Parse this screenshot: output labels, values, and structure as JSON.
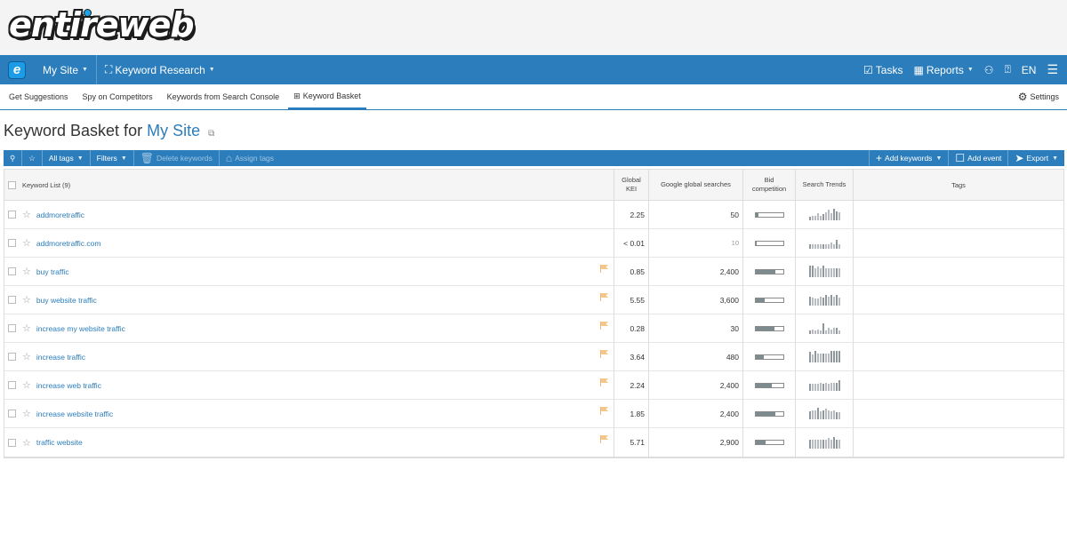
{
  "logo": {
    "text": "entireweb"
  },
  "topnav": {
    "app_icon": "e",
    "site": "My Site",
    "module": "Keyword Research",
    "tasks": "Tasks",
    "reports": "Reports",
    "lang": "EN"
  },
  "subnav": {
    "tabs": [
      "Get Suggestions",
      "Spy on Competitors",
      "Keywords from Search Console",
      "Keyword Basket"
    ],
    "settings": "Settings"
  },
  "page": {
    "title_prefix": "Keyword Basket for",
    "site": "My Site"
  },
  "toolbar": {
    "all_tags": "All tags",
    "filters": "Filters",
    "delete": "Delete keywords",
    "assign": "Assign tags",
    "add_keywords": "Add keywords",
    "add_event": "Add event",
    "export": "Export"
  },
  "table": {
    "headers": {
      "keyword": "Keyword List (9)",
      "kei_1": "Global",
      "kei_2": "KEI",
      "searches": "Google global searches",
      "bid_1": "Bid",
      "bid_2": "competition",
      "trends": "Search Trends",
      "tags": "Tags"
    },
    "rows": [
      {
        "keyword": "addmoretraffic",
        "kei": "2.25",
        "searches": "50",
        "flag": false,
        "bid": 0.12,
        "trend": [
          3,
          4,
          4,
          6,
          4,
          5,
          7,
          9,
          6,
          10,
          8,
          7
        ]
      },
      {
        "keyword": "addmoretraffic.com",
        "kei": "< 0.01",
        "searches": "10",
        "muted": true,
        "flag": false,
        "bid": 0.02,
        "trend": [
          4,
          4,
          4,
          4,
          4,
          4,
          4,
          4,
          5,
          4,
          8,
          4
        ]
      },
      {
        "keyword": "buy traffic",
        "kei": "0.85",
        "searches": "2,400",
        "flag": true,
        "bid": 0.72,
        "trend": [
          10,
          10,
          8,
          9,
          8,
          10,
          8,
          8,
          8,
          8,
          8,
          8
        ]
      },
      {
        "keyword": "buy website traffic",
        "kei": "5.55",
        "searches": "3,600",
        "flag": true,
        "bid": 0.35,
        "trend": [
          8,
          7,
          6,
          6,
          8,
          7,
          9,
          8,
          9,
          8,
          9,
          7
        ]
      },
      {
        "keyword": "increase my website traffic",
        "kei": "0.28",
        "searches": "30",
        "flag": true,
        "bid": 0.7,
        "trend": [
          3,
          4,
          3,
          4,
          3,
          9,
          3,
          5,
          4,
          5,
          5,
          3
        ]
      },
      {
        "keyword": "increase traffic",
        "kei": "3.64",
        "searches": "480",
        "flag": true,
        "bid": 0.3,
        "trend": [
          9,
          7,
          10,
          8,
          8,
          8,
          8,
          8,
          10,
          10,
          10,
          10
        ]
      },
      {
        "keyword": "increase web traffic",
        "kei": "2.24",
        "searches": "2,400",
        "flag": true,
        "bid": 0.6,
        "trend": [
          6,
          6,
          6,
          6,
          7,
          6,
          7,
          6,
          7,
          7,
          7,
          9
        ]
      },
      {
        "keyword": "increase website traffic",
        "kei": "1.85",
        "searches": "2,400",
        "flag": true,
        "bid": 0.72,
        "trend": [
          7,
          8,
          8,
          10,
          7,
          8,
          9,
          8,
          7,
          8,
          6,
          6
        ]
      },
      {
        "keyword": "traffic website",
        "kei": "5.71",
        "searches": "2,900",
        "flag": true,
        "bid": 0.38,
        "trend": [
          8,
          8,
          8,
          8,
          8,
          8,
          8,
          9,
          8,
          10,
          8,
          8
        ]
      }
    ]
  },
  "colors": {
    "brand": "#2b7dbc",
    "flag": "#f5c58a",
    "bar": "#7d8a8e"
  }
}
